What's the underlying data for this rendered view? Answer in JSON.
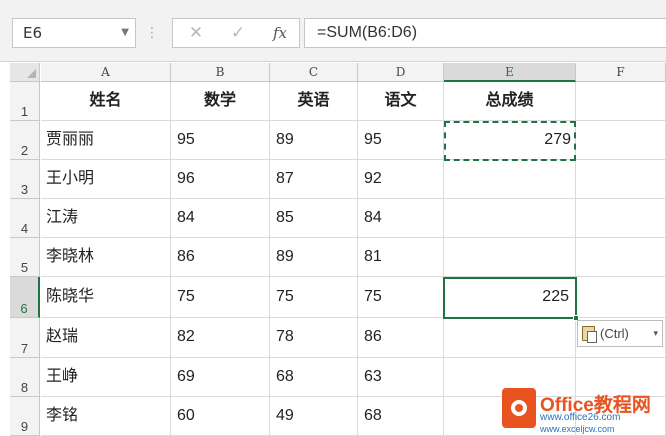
{
  "name_box": {
    "value": "E6",
    "dropdown_icon": "chevron-down-icon"
  },
  "formula_bar": {
    "separator": "⋮",
    "cancel_symbol": "✕",
    "enter_symbol": "✓",
    "function_symbol": "fx",
    "formula": "=SUM(B6:D6)"
  },
  "columns": [
    "A",
    "B",
    "C",
    "D",
    "E",
    "F"
  ],
  "rows": [
    "1",
    "2",
    "3",
    "4",
    "5",
    "6",
    "7",
    "8",
    "9"
  ],
  "headers": [
    "姓名",
    "数学",
    "英语",
    "语文",
    "总成绩"
  ],
  "students": [
    {
      "name": "贾丽丽",
      "math": "95",
      "english": "89",
      "chinese": "95",
      "total": "279"
    },
    {
      "name": "王小明",
      "math": "96",
      "english": "87",
      "chinese": "92",
      "total": ""
    },
    {
      "name": "江涛",
      "math": "84",
      "english": "85",
      "chinese": "84",
      "total": ""
    },
    {
      "name": "李晓林",
      "math": "86",
      "english": "89",
      "chinese": "81",
      "total": ""
    },
    {
      "name": "陈晓华",
      "math": "75",
      "english": "75",
      "chinese": "75",
      "total": "225"
    },
    {
      "name": "赵瑞",
      "math": "82",
      "english": "78",
      "chinese": "86",
      "total": ""
    },
    {
      "name": "王峥",
      "math": "69",
      "english": "68",
      "chinese": "63",
      "total": ""
    },
    {
      "name": "李铭",
      "math": "60",
      "english": "49",
      "chinese": "68",
      "total": ""
    }
  ],
  "selection": {
    "active_cell": "E6",
    "copied_cell": "E2"
  },
  "paste_options": {
    "label": "(Ctrl)",
    "icon": "clipboard-paste-icon",
    "caret": "▾"
  },
  "watermark": {
    "title": "Office教程网",
    "url1": "www.office26.com",
    "url2": "www.exceljcw.com"
  },
  "colors": {
    "accent": "#217346",
    "watermark_orange": "#e8531f",
    "watermark_blue": "#2d72b8"
  }
}
